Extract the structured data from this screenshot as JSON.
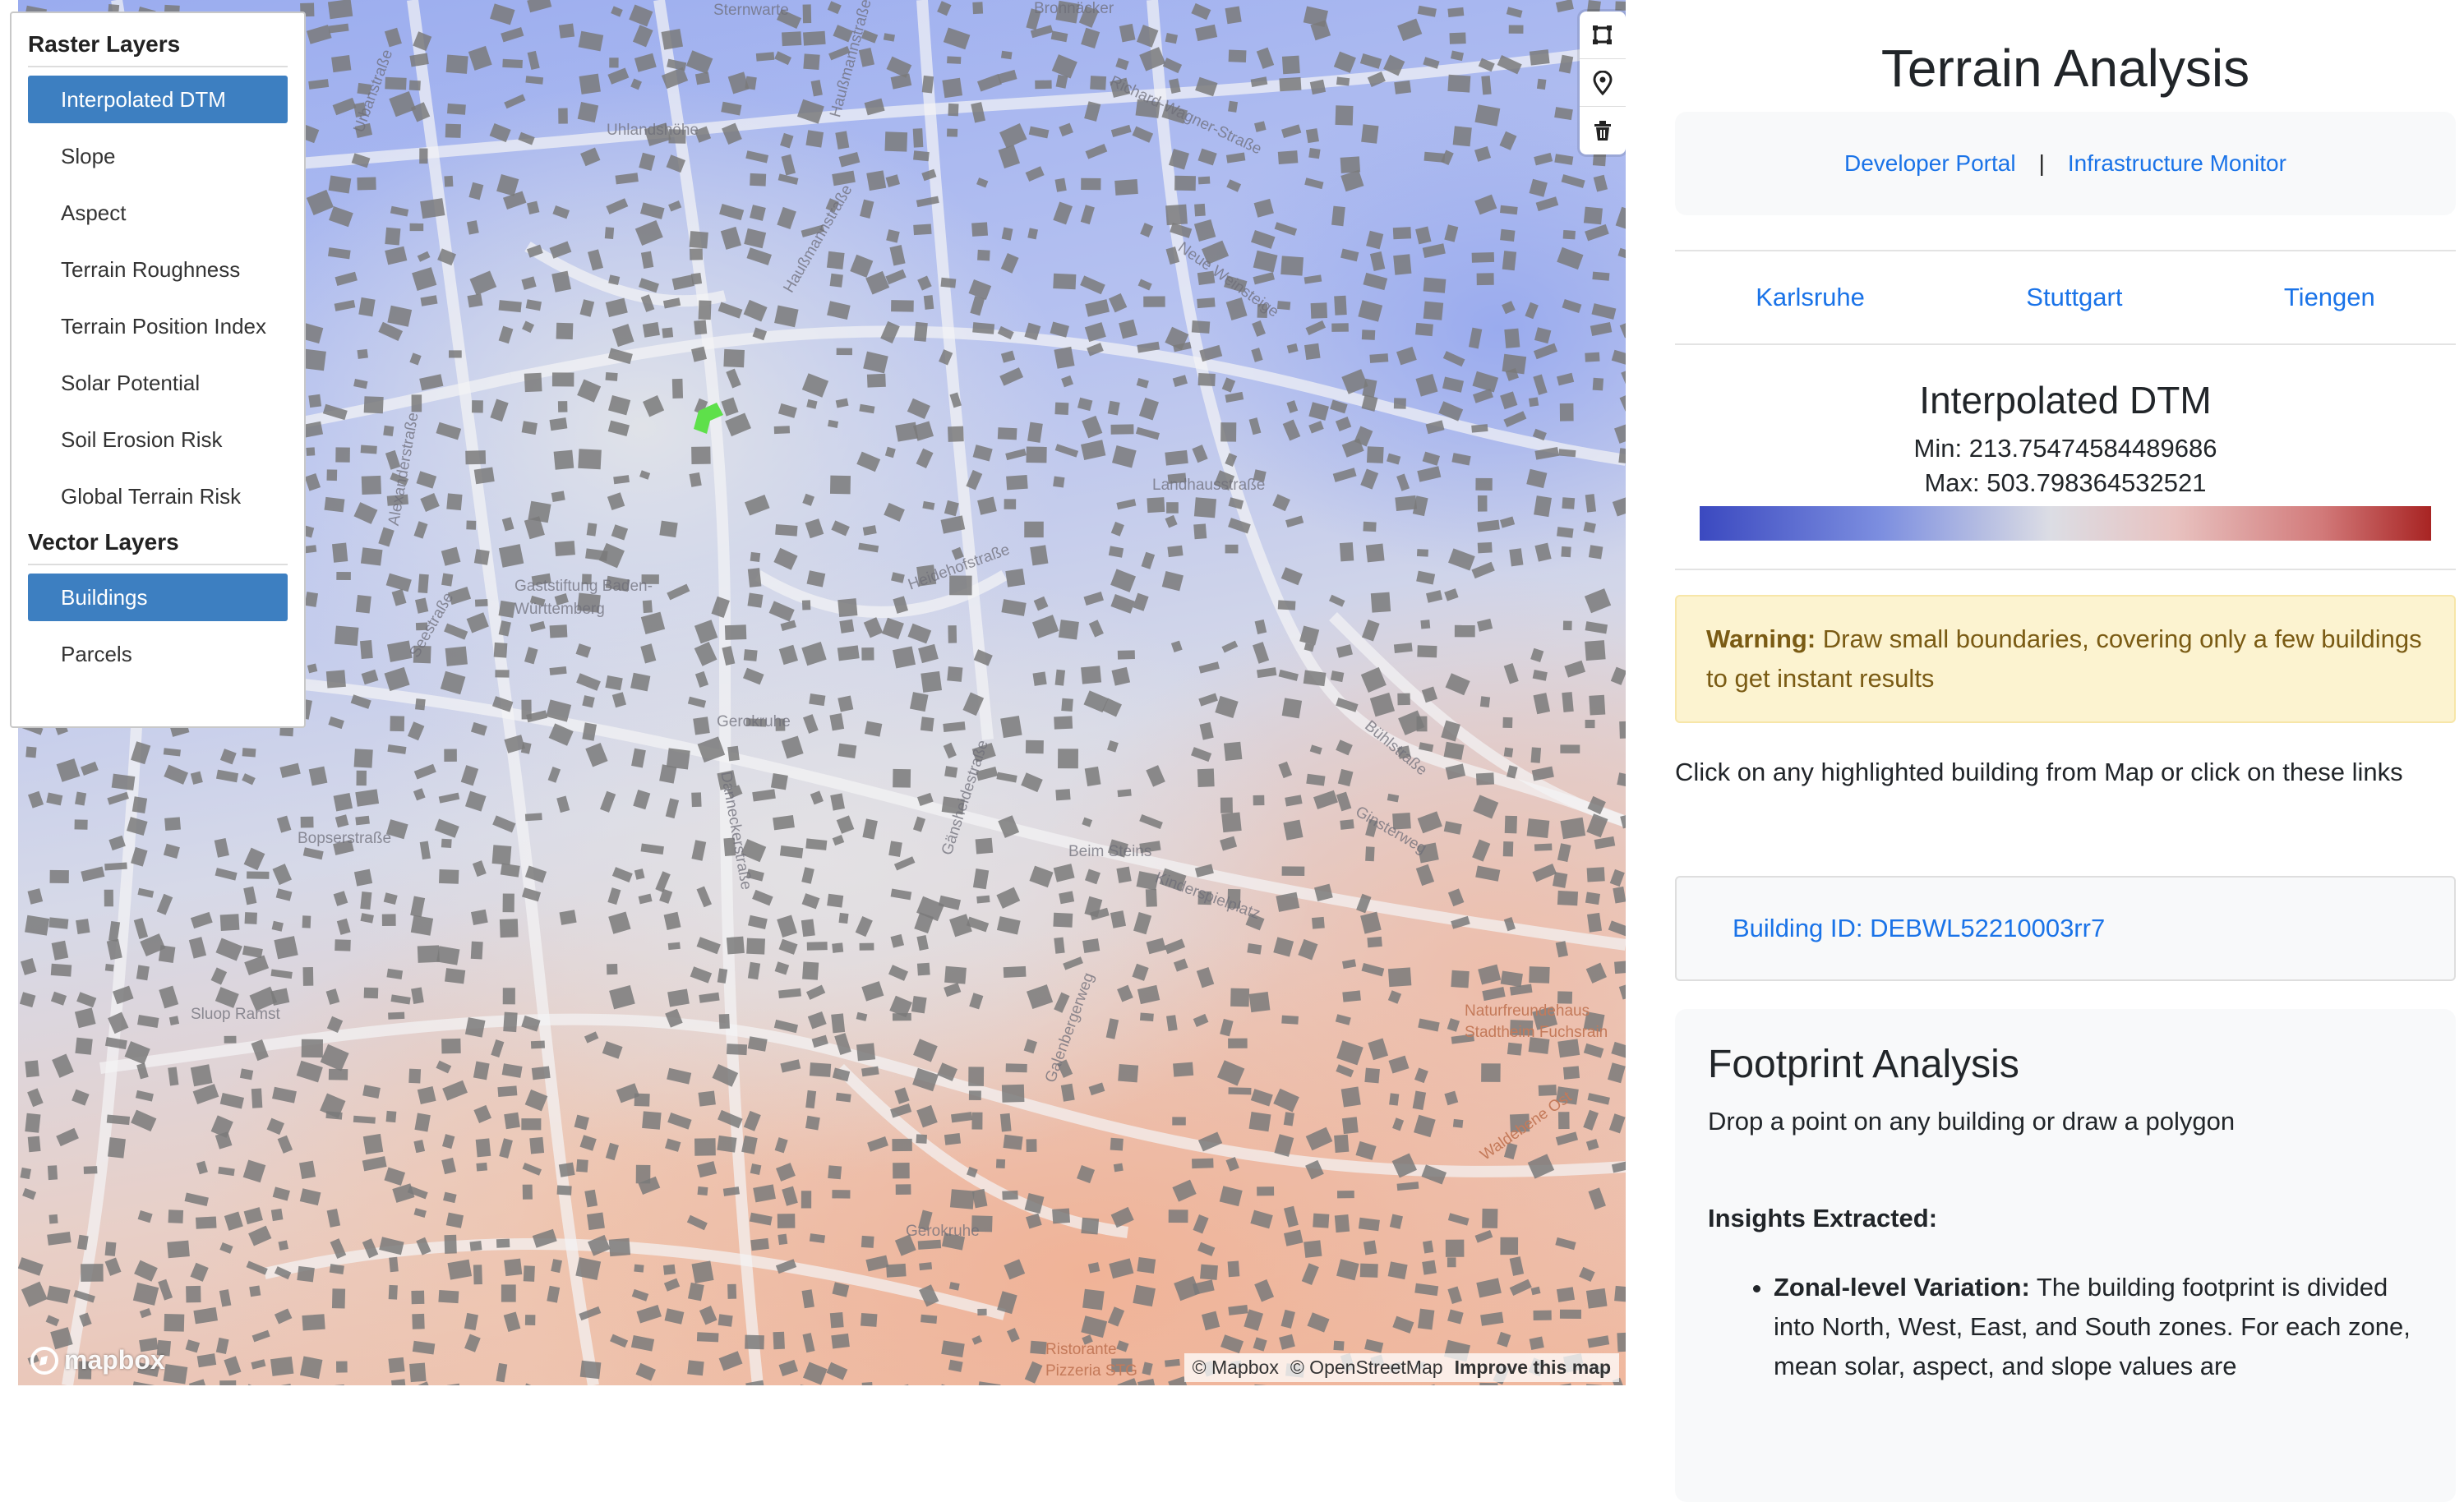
{
  "app": {
    "title": "Terrain Analysis",
    "links": [
      "Developer Portal",
      "Infrastructure Monitor"
    ],
    "link_separator": "|",
    "cities": [
      "Karlsruhe",
      "Stuttgart",
      "Tiengen"
    ]
  },
  "layer_panel": {
    "raster_heading": "Raster Layers",
    "raster_layers": [
      "Interpolated DTM",
      "Slope",
      "Aspect",
      "Terrain Roughness",
      "Terrain Position Index",
      "Solar Potential",
      "Soil Erosion Risk",
      "Global Terrain Risk"
    ],
    "raster_active": "Interpolated DTM",
    "vector_heading": "Vector Layers",
    "vector_layers": [
      "Buildings",
      "Parcels"
    ],
    "vector_active": "Buildings"
  },
  "legend": {
    "title": "Interpolated DTM",
    "min_label": "Min: 213.75474584489686",
    "max_label": "Max: 503.798364532521",
    "colors": [
      "#3b49c0",
      "#7d8fe0",
      "#dcdde4",
      "#e8c2c0",
      "#d27a7a",
      "#a82423"
    ]
  },
  "warning": {
    "label": "Warning:",
    "text": "Draw small boundaries, covering only a few buildings to get instant results"
  },
  "click_hint": "Click on any highlighted building from Map or click on these links",
  "building_link": "Building ID: DEBWL52210003rr7",
  "footprint": {
    "title": "Footprint Analysis",
    "subtitle": "Drop a point on any building or draw a polygon",
    "insights_heading": "Insights Extracted:",
    "insight_term": "Zonal-level Variation:",
    "insight_text": "The building footprint is divided into North, West, East, and South zones. For each zone, mean solar, aspect, and slope values are"
  },
  "map": {
    "attribution": [
      "© Mapbox",
      "© OpenStreetMap"
    ],
    "improve_link": "Improve this map",
    "logo_text": "mapbox",
    "draw_tools": [
      "polygon-tool-icon",
      "point-tool-icon",
      "trash-icon"
    ],
    "labels": [
      "Sternwarte",
      "Uhlandshöhe",
      "Bronnäcker",
      "Urbanstraße",
      "Haußmannstraße",
      "Alexanderstraße",
      "Haußmann­straße",
      "Neue Weinsteige",
      "Landhausstraße",
      "Gaststiftung Baden-Württemberg",
      "Gerokruhe",
      "Dannecker­straße",
      "Bopserstraße",
      "Sluop Ramst",
      "Heidehofstraße",
      "Gänsheidestraße",
      "Galenbergerweg",
      "Ginsterweg",
      "Beim Steins",
      "Naturfreundehaus Stadtheim Fuchsrain",
      "Waldebene Ost",
      "Gerokruhe",
      "Ristorante Pizzeria STG",
      "Kinderspielplatz",
      "Richard-Wagner-Straße",
      "Seestraße",
      "Bühlstraße"
    ],
    "colors": {
      "low": "#3b49c0",
      "mid": "#dcdde4",
      "high": "#a82423",
      "buildings": "#7a7a7a",
      "roads": "#f3f3f5",
      "highlight": "#5ee04a"
    }
  }
}
